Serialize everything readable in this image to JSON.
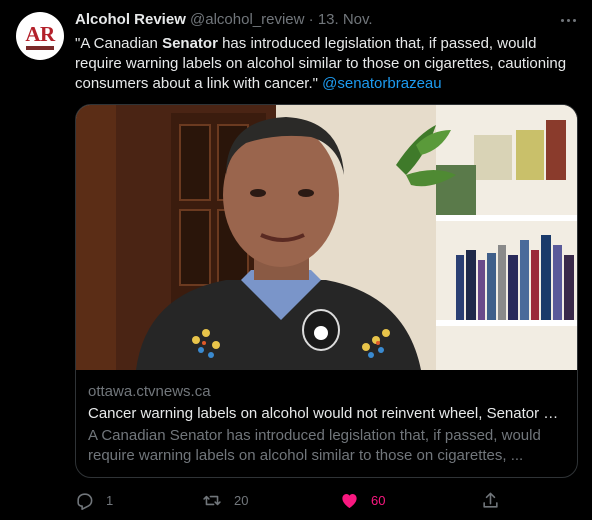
{
  "author": {
    "name": "Alcohol Review",
    "handle": "@alcohol_review",
    "separator": "·",
    "date": "13. Nov.",
    "avatar_text": "AR"
  },
  "tweet": {
    "text_part1": "\"A Canadian ",
    "text_bold": "Senator",
    "text_part2": " has introduced legislation that, if passed, would require warning labels on alcohol similar to those on cigarettes, cautioning consumers about a link with cancer.\" ",
    "mention": "@senatorbrazeau"
  },
  "card": {
    "domain": "ottawa.ctvnews.ca",
    "title": "Cancer warning labels on alcohol would not reinvent wheel, Senator says",
    "description_line1": "A Canadian Senator has introduced legislation that, if passed, would",
    "description_line2": "require warning labels on alcohol similar to those on cigarettes, ..."
  },
  "actions": {
    "reply_count": "1",
    "retweet_count": "20",
    "like_count": "60"
  },
  "colors": {
    "background": "#000000",
    "text": "#e7e9ea",
    "secondary": "#71767b",
    "link": "#1d9bf0",
    "like": "#f91880",
    "border": "#2f3336"
  },
  "icons": [
    "more-icon",
    "reply-icon",
    "retweet-icon",
    "like-icon",
    "share-icon"
  ]
}
